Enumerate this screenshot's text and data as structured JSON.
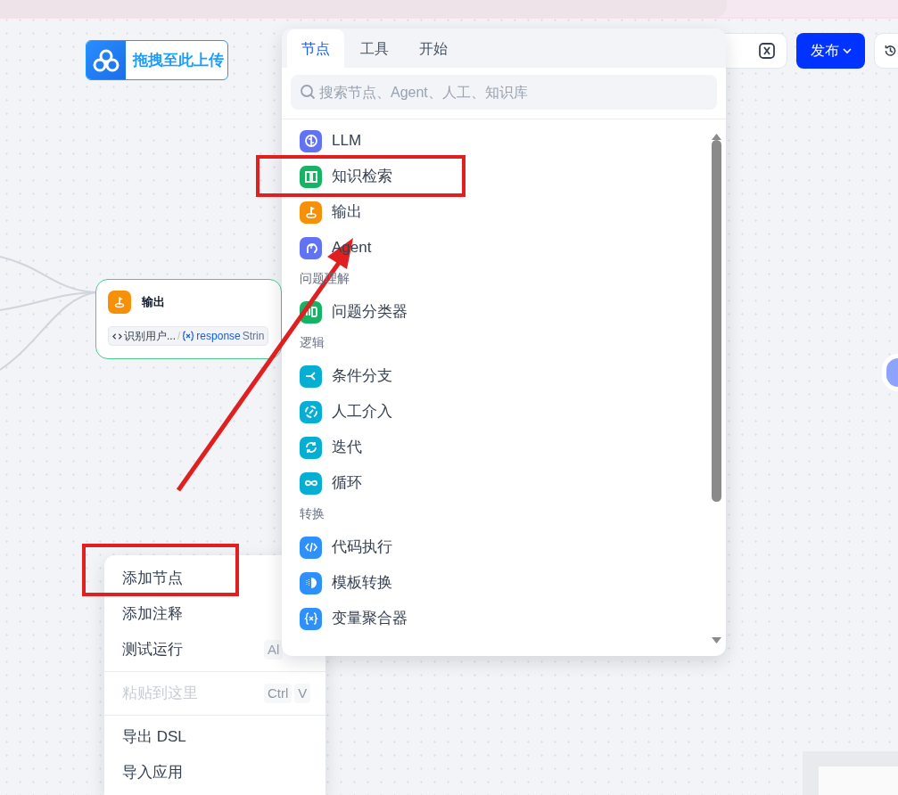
{
  "upload_button": {
    "label": "拖拽至此上传"
  },
  "toolbar": {
    "publish": {
      "label": "发布"
    }
  },
  "node": {
    "title": "输出",
    "variable": {
      "source": "识别用户...",
      "separator": "/",
      "name": "response",
      "type": "Strin"
    }
  },
  "palette": {
    "tabs": [
      {
        "label": "节点",
        "selected": true
      },
      {
        "label": "工具",
        "selected": false
      },
      {
        "label": "开始",
        "selected": false
      }
    ],
    "search": {
      "placeholder": "搜索节点、Agent、人工、知识库"
    },
    "sections": [
      {
        "items": [
          {
            "label": "LLM",
            "color": "#6172f3"
          },
          {
            "label": "知识检索",
            "color": "#16b364"
          },
          {
            "label": "输出",
            "color": "#f79009"
          },
          {
            "label": "Agent",
            "color": "#6172f3"
          }
        ]
      },
      {
        "title": "问题理解",
        "items": [
          {
            "label": "问题分类器",
            "color": "#16b364"
          }
        ]
      },
      {
        "title": "逻辑",
        "items": [
          {
            "label": "条件分支",
            "color": "#06aed4"
          },
          {
            "label": "人工介入",
            "color": "#06aed4"
          },
          {
            "label": "迭代",
            "color": "#06aed4"
          },
          {
            "label": "循环",
            "color": "#06aed4"
          }
        ]
      },
      {
        "title": "转换",
        "items": [
          {
            "label": "代码执行",
            "color": "#2e90fa"
          },
          {
            "label": "模板转换",
            "color": "#2e90fa"
          },
          {
            "label": "变量聚合器",
            "color": "#2e90fa"
          }
        ]
      }
    ]
  },
  "context_menu": {
    "groups": [
      {
        "items": [
          {
            "label": "添加节点",
            "disabled": false
          },
          {
            "label": "添加注释",
            "disabled": false
          },
          {
            "label": "测试运行",
            "disabled": false,
            "shortcut": [
              "Al"
            ]
          }
        ]
      },
      {
        "items": [
          {
            "label": "粘贴到这里",
            "disabled": true,
            "shortcut": [
              "Ctrl",
              "V"
            ]
          }
        ]
      },
      {
        "items": [
          {
            "label": "导出 DSL",
            "disabled": false
          },
          {
            "label": "导入应用",
            "disabled": false
          }
        ]
      }
    ]
  }
}
